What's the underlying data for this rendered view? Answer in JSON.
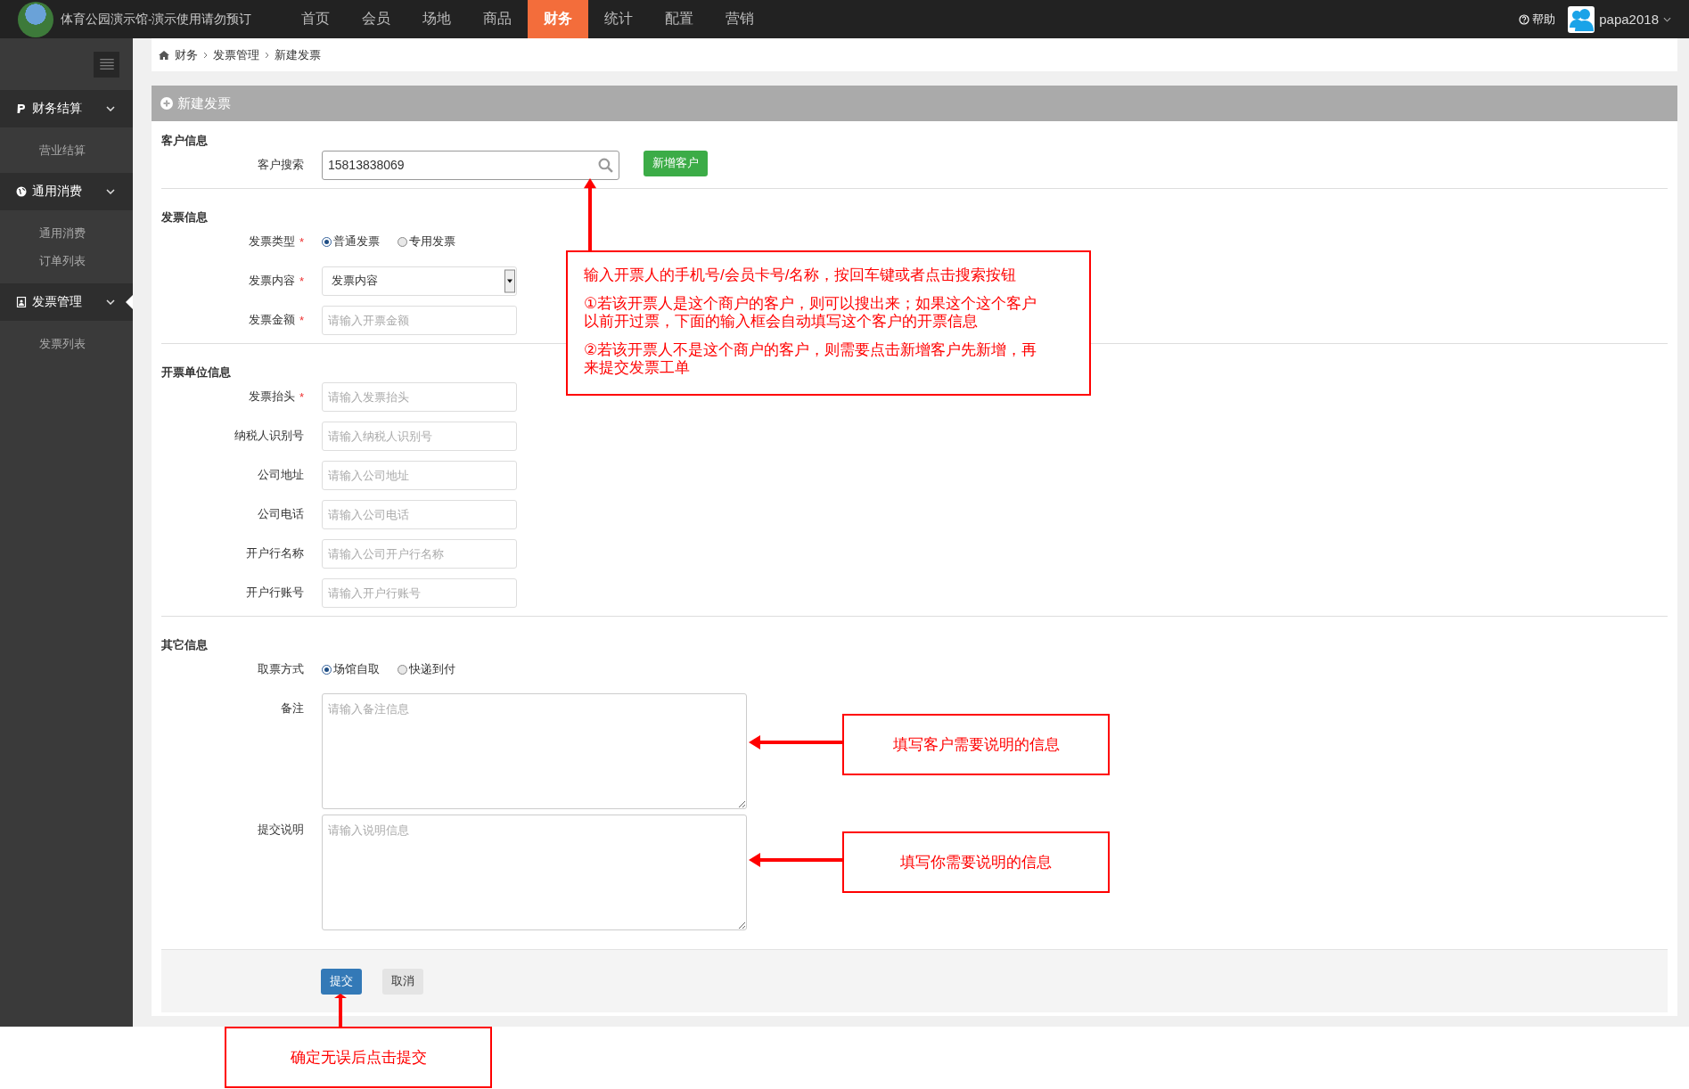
{
  "header": {
    "site_title": "体育公园演示馆-演示使用请勿预订",
    "nav": [
      {
        "label": "首页",
        "selected": false
      },
      {
        "label": "会员",
        "selected": false
      },
      {
        "label": "场地",
        "selected": false
      },
      {
        "label": "商品",
        "selected": false
      },
      {
        "label": "财务",
        "selected": true
      },
      {
        "label": "统计",
        "selected": false
      },
      {
        "label": "配置",
        "selected": false
      },
      {
        "label": "营销",
        "selected": false
      }
    ],
    "help": "帮助",
    "user": "papa2018"
  },
  "sidebar": {
    "groups": [
      {
        "title": "财务结算",
        "expanded": true,
        "selected": false,
        "items": [
          "营业结算"
        ]
      },
      {
        "title": "通用消费",
        "expanded": true,
        "selected": false,
        "items": [
          "通用消费",
          "订单列表"
        ]
      },
      {
        "title": "发票管理",
        "expanded": true,
        "selected": true,
        "items": [
          "发票列表"
        ]
      }
    ]
  },
  "breadcrumb": [
    "财务",
    "发票管理",
    "新建发票"
  ],
  "panel": {
    "title": "新建发票",
    "sections": [
      {
        "heading": "客户信息",
        "fields": [
          {
            "kind": "search",
            "label": "客户搜索",
            "value": "15813838069",
            "button": "新增客户"
          }
        ]
      },
      {
        "heading": "发票信息",
        "fields": [
          {
            "kind": "radio",
            "label": "发票类型",
            "required_mark": "*",
            "options": [
              {
                "label": "普通发票",
                "selected": true
              },
              {
                "label": "专用发票",
                "selected": false
              }
            ]
          },
          {
            "kind": "select",
            "label": "发票内容",
            "required_mark": "*",
            "value": "发票内容"
          },
          {
            "kind": "text",
            "label": "发票金额",
            "required_mark": "*",
            "placeholder": "请输入开票金额"
          }
        ]
      },
      {
        "heading": "开票单位信息",
        "fields": [
          {
            "kind": "text",
            "label": "发票抬头",
            "required_mark": "*",
            "placeholder": "请输入发票抬头"
          },
          {
            "kind": "text",
            "label": "纳税人识别号",
            "placeholder": "请输入纳税人识别号"
          },
          {
            "kind": "text",
            "label": "公司地址",
            "placeholder": "请输入公司地址"
          },
          {
            "kind": "text",
            "label": "公司电话",
            "placeholder": "请输入公司电话"
          },
          {
            "kind": "text",
            "label": "开户行名称",
            "placeholder": "请输入公司开户行名称"
          },
          {
            "kind": "text",
            "label": "开户行账号",
            "placeholder": "请输入开户行账号"
          }
        ]
      },
      {
        "heading": "其它信息",
        "fields": [
          {
            "kind": "radio",
            "label": "取票方式",
            "options": [
              {
                "label": "场馆自取",
                "selected": true
              },
              {
                "label": "快递到付",
                "selected": false
              }
            ]
          },
          {
            "kind": "textarea",
            "label": "备注",
            "placeholder": "请输入备注信息"
          },
          {
            "kind": "textarea",
            "label": "提交说明",
            "placeholder": "请输入说明信息"
          }
        ]
      }
    ],
    "actions": [
      {
        "label": "提交",
        "kind": "primary"
      },
      {
        "label": "取消",
        "kind": "default"
      }
    ]
  },
  "annotations": [
    {
      "paragraphs": [
        "输入开票人的手机号/会员卡号/名称，按回车键或者点击搜索按钮",
        "①若该开票人是这个商户的客户，则可以搜出来；如果这个这个客户以前开过票，下面的输入框会自动填写这个客户的开票信息",
        "②若该开票人不是这个商户的客户，则需要点击新增客户先新增，再来提交发票工单"
      ]
    },
    {
      "paragraphs": [
        "填写客户需要说明的信息"
      ]
    },
    {
      "paragraphs": [
        "填写你需要说明的信息"
      ]
    },
    {
      "paragraphs": [
        "确定无误后点击提交"
      ]
    }
  ]
}
